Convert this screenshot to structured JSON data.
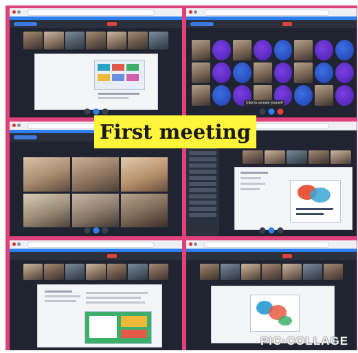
{
  "collage": {
    "banner_text": "First meeting",
    "watermark_text": "PIC·COLLAGE",
    "frame_color": "#e0417a",
    "banner_color": "#fff53a"
  },
  "panels": [
    {
      "id": "top-left",
      "content": "shared-slide"
    },
    {
      "id": "top-right",
      "content": "participant-grid",
      "tooltip": "Click to unmute yourself"
    },
    {
      "id": "middle-left",
      "content": "gallery-view"
    },
    {
      "id": "middle-right",
      "content": "participants-list-and-slide"
    },
    {
      "id": "bottom-left",
      "content": "shared-document"
    },
    {
      "id": "bottom-right",
      "content": "shared-image"
    }
  ]
}
